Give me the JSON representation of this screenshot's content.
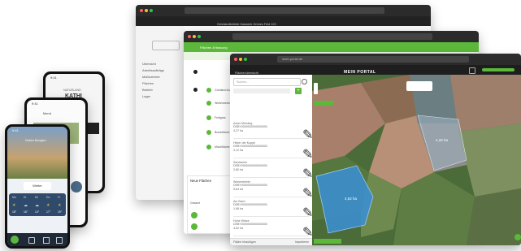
{
  "window_back": {
    "top_label": "Grünlandbetrieb Gaswerk Grünes Feld 123",
    "sidebar": [
      "Übersicht",
      "Arbeitsaufträge",
      "Maßnahmen",
      "Flächen",
      "Betrieb",
      "Lager",
      "Dokumente"
    ]
  },
  "window_mid": {
    "header": "Flächen-Erfassung",
    "section": "Neue Flächen",
    "rows": [
      "Grünland Ackerland",
      "Winterweizen 4,2 ha",
      "Feldgras",
      "Brachfläche",
      "Mischfläche"
    ],
    "status": "Gesamt"
  },
  "window_front": {
    "url": "mein.portal.de",
    "left_title": "Flächenübersicht",
    "search_placeholder": "Suchen...",
    "logo": "MEIN PORTAL",
    "add": "+",
    "items": [
      {
        "name": "Acker Meisling",
        "sub": "DEBY0000000000000000",
        "size": "4,27 ha"
      },
      {
        "name": "Hinter der Kuppe",
        "sub": "DEBY0000000000000000",
        "size": "3,12 ha"
      },
      {
        "name": "Sandacker",
        "sub": "DEBY0000000000000000",
        "size": "2,80 ha"
      },
      {
        "name": "Wiesenbreite",
        "sub": "DEBY0000000000000000",
        "size": "5,64 ha"
      },
      {
        "name": "Am Bach",
        "sub": "DEBY0000000000000000",
        "size": "1,98 ha"
      },
      {
        "name": "Hohe Wiese",
        "sub": "DEBY0000000000000000",
        "size": "4,62 ha"
      }
    ],
    "map_label_1": "4,26 ha",
    "map_label_2": "4,62 ha",
    "footer_left": "Fläche hinzufügen",
    "footer_right": "Importieren"
  },
  "phone_front": {
    "time": "9:41",
    "greeting": "Guten Morgen",
    "weather_title": "Wetter",
    "days": [
      "Mo",
      "Di",
      "Mi",
      "Do",
      "Fr"
    ],
    "temps": [
      "18°",
      "16°",
      "14°",
      "17°",
      "19°"
    ]
  },
  "phone_mid": {
    "time": "9:41",
    "title": "Menü"
  },
  "phone_back": {
    "time": "9:41",
    "title": "KATHI",
    "subtitle": "NATURLAND"
  },
  "colors": {
    "accent": "#5cb83a",
    "dark": "#1e1e1e",
    "map_blue": "#3a8fd6"
  }
}
